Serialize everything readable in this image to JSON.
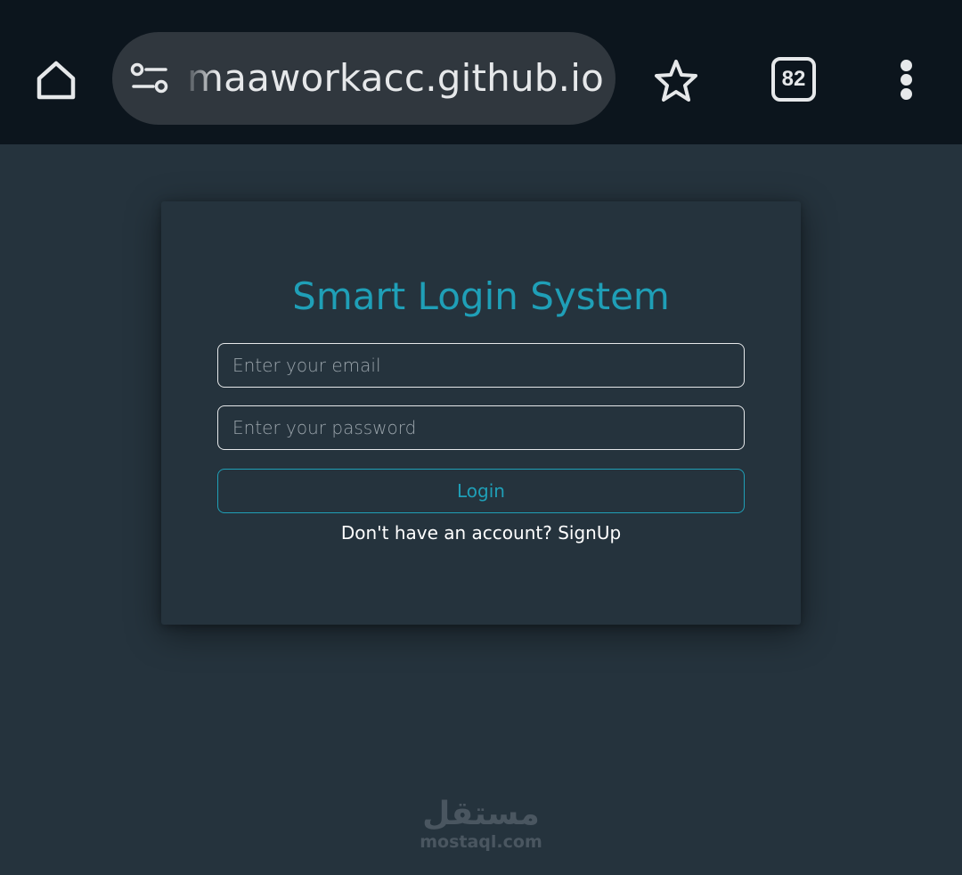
{
  "browser": {
    "url": "nimaaworkacc.github.io",
    "tab_count": "82"
  },
  "card": {
    "title": "Smart Login System",
    "email_placeholder": "Enter your email",
    "password_placeholder": "Enter your password",
    "login_label": "Login",
    "signup_prompt": "Don't have an account? ",
    "signup_link": "SignUp"
  },
  "watermark": {
    "arabic": "مستقل",
    "latin": "mostaql.com"
  },
  "colors": {
    "accent": "#1f9fb7",
    "background": "#25333d",
    "toolbar": "#0c151d"
  },
  "icons": {
    "home": "home-icon",
    "site_settings": "tune-icon",
    "bookmark": "star-outline-icon",
    "tabs": "tab-switcher-icon",
    "menu": "more-vertical-icon"
  }
}
